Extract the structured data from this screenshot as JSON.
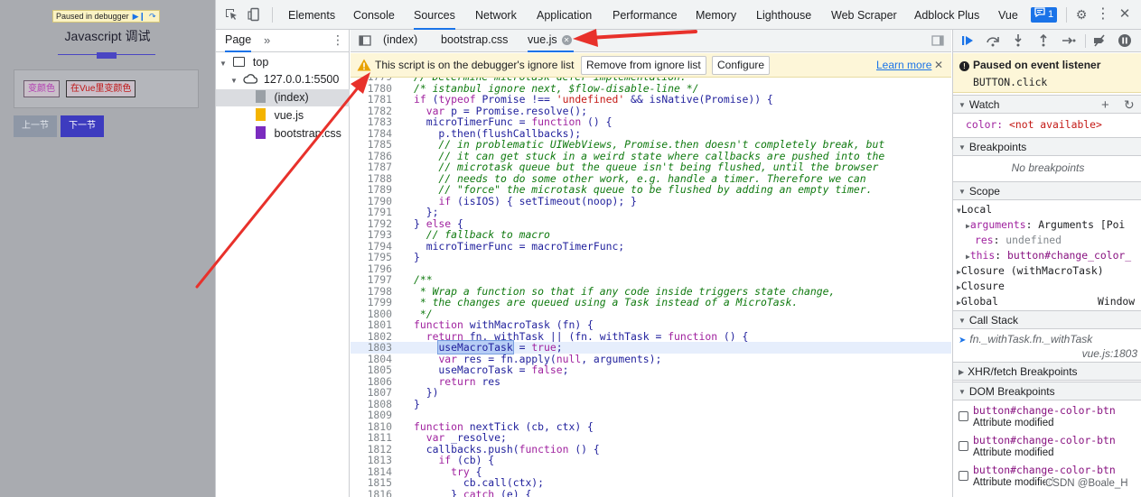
{
  "page": {
    "paused_label": "Paused in debugger",
    "title": "Javascript 调试",
    "btn_change_color": "变颜色",
    "btn_change_color_vue": "在Vue里变颜色",
    "btn_prev": "上一节",
    "btn_next": "下一节"
  },
  "devtools": {
    "panels": [
      "Elements",
      "Console",
      "Sources",
      "Network",
      "Application",
      "Performance",
      "Memory",
      "Lighthouse",
      "Web Scraper",
      "Adblock Plus",
      "Vue"
    ],
    "active_panel": "Sources",
    "messages_count": "1",
    "navigator": {
      "tab": "Page",
      "more": "»",
      "tree": [
        {
          "label": "top",
          "kind": "frame"
        },
        {
          "label": "127.0.0.1:5500",
          "kind": "origin"
        },
        {
          "label": "(index)",
          "kind": "html",
          "selected": true
        },
        {
          "label": "vue.js",
          "kind": "js"
        },
        {
          "label": "bootstrap.css",
          "kind": "css"
        }
      ]
    },
    "editor": {
      "tabs": [
        "(index)",
        "bootstrap.css",
        "vue.js"
      ],
      "active_tab": "vue.js",
      "infobar": {
        "message": "This script is on the debugger's ignore list",
        "remove_button": "Remove from ignore list",
        "configure_button": "Configure",
        "learn_more": "Learn more"
      },
      "first_line": 1779,
      "highlight_line": 1803,
      "lines": [
        "// Determine microtask defer implementation.",
        "/* istanbul ignore next, $flow-disable-line */",
        "if (typeof Promise !== 'undefined' && isNative(Promise)) {",
        "  var p = Promise.resolve();",
        "  microTimerFunc = function () {",
        "    p.then(flushCallbacks);",
        "    // in problematic UIWebViews, Promise.then doesn't completely break, but",
        "    // it can get stuck in a weird state where callbacks are pushed into the",
        "    // microtask queue but the queue isn't being flushed, until the browser",
        "    // needs to do some other work, e.g. handle a timer. Therefore we can",
        "    // \"force\" the microtask queue to be flushed by adding an empty timer.",
        "    if (isIOS) { setTimeout(noop); }",
        "  };",
        "} else {",
        "  // fallback to macro",
        "  microTimerFunc = macroTimerFunc;",
        "}",
        "",
        "/**",
        " * Wrap a function so that if any code inside triggers state change,",
        " * the changes are queued using a Task instead of a MicroTask.",
        " */",
        "function withMacroTask (fn) {",
        "  return fn._withTask || (fn._withTask = function () {",
        "    useMacroTask = true;",
        "    var res = fn.apply(null, arguments);",
        "    useMacroTask = false;",
        "    return res",
        "  })",
        "}",
        "",
        "function nextTick (cb, ctx) {",
        "  var _resolve;",
        "  callbacks.push(function () {",
        "    if (cb) {",
        "      try {",
        "        cb.call(ctx);",
        "      } catch (e) {"
      ]
    },
    "sidebar": {
      "paused_title": "Paused on event listener",
      "paused_detail": "BUTTON.click",
      "watch_title": "Watch",
      "watch_expr_name": "color",
      "watch_expr_value": "<not available>",
      "breakpoints_title": "Breakpoints",
      "no_breakpoints": "No breakpoints",
      "scope_title": "Scope",
      "scope_local": "Local",
      "scope_arguments_key": "arguments",
      "scope_arguments_val": "Arguments [Poi",
      "scope_res_key": "res",
      "scope_res_val": "undefined",
      "scope_this_key": "this",
      "scope_this_val": "button#change_color_",
      "scope_closure_1": "Closure (withMacroTask)",
      "scope_closure_2": "Closure",
      "scope_global": "Global",
      "scope_global_val": "Window",
      "callstack_title": "Call Stack",
      "callstack_fn": "fn._withTask.fn._withTask",
      "callstack_loc": "vue.js:1803",
      "xhr_title": "XHR/fetch Breakpoints",
      "dom_title": "DOM Breakpoints",
      "dom_items": [
        {
          "selector": "button#change-color-btn",
          "type": "Attribute modified"
        },
        {
          "selector": "button#change-color-btn",
          "type": "Attribute modified"
        },
        {
          "selector": "button#change-color-btn",
          "type": "Attribute modified"
        }
      ],
      "watermark": "CSDN @Boale_H"
    }
  },
  "colors": {
    "accent": "#1a73e8",
    "arrow": "#e8312b",
    "infobar_bg": "#fdf6d8",
    "page_bg": "#a9abb0"
  }
}
